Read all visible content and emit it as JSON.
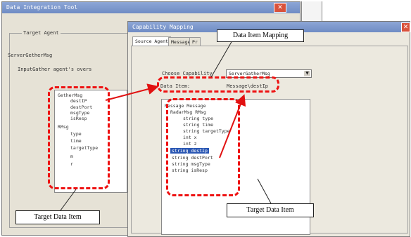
{
  "back_window": {
    "title": "Data Integration Tool",
    "target_agent_label": "Target Agent",
    "server_name": "ServerGetherMsg",
    "input_label": "InputGather agent's overs",
    "tree": [
      "GetherMsg",
      "destIP",
      "destPort",
      "msgType",
      "isResp",
      "RMsg",
      "type",
      "time",
      "targetType",
      "m",
      "r"
    ]
  },
  "front_window": {
    "title": "Capability Mapping",
    "tabs": [
      "Source Agent",
      "Message",
      "Pr"
    ],
    "choose_capability_label": "Choose Capability",
    "choose_capability_value": "ServerGatherMsg",
    "data_item_label": "Data Item:",
    "data_item_value": "Message\\destIp",
    "tree": [
      "Message Message",
      "RadarMsg RMsg",
      "string type",
      "string time",
      "string targetType",
      "int x",
      "int z",
      "string destIp",
      "string destPort",
      "string msgType",
      "string isResp"
    ]
  },
  "annotations": {
    "data_item_mapping": "Data Item Mapping",
    "target_data_item_left": "Target Data Item",
    "target_data_item_right": "Target Data Item"
  },
  "colors": {
    "highlight": "#e11111",
    "titlebar": "#7b95cc",
    "window_bg": "#e6e2d6"
  }
}
